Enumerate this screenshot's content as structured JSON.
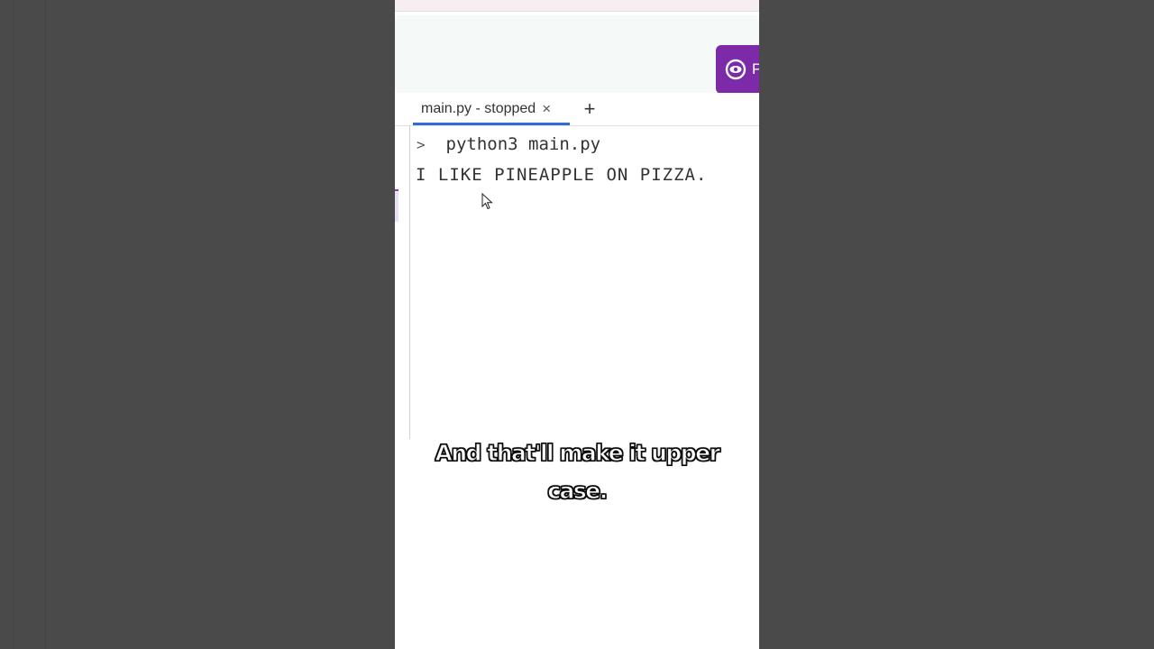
{
  "run_button": {
    "label": "P"
  },
  "tabs": [
    {
      "label": "main.py - stopped",
      "close_symbol": "×"
    }
  ],
  "add_tab_symbol": "+",
  "console": {
    "prompt_symbol": ">",
    "command": "python3 main.py",
    "output": "I LIKE PINEAPPLE ON PIZZA."
  },
  "caption": {
    "line1": "And that'll make it upper",
    "line2": "case."
  },
  "colors": {
    "run_button_bg": "#7d2aa8",
    "tab_underline": "#2f6bd1"
  }
}
